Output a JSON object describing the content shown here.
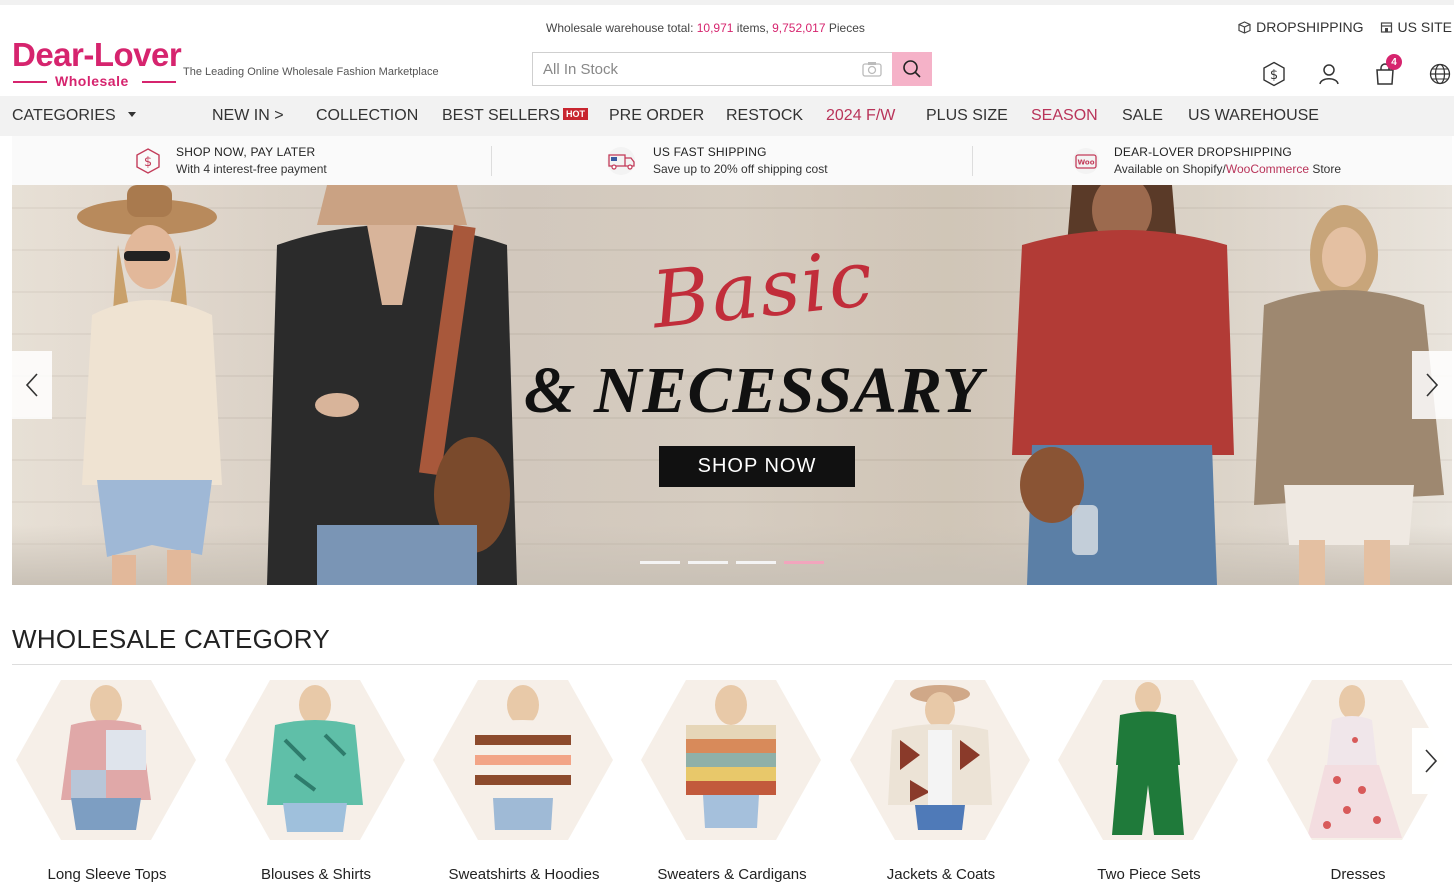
{
  "header": {
    "logo_main": "Dear-Lover",
    "logo_sub": "Wholesale",
    "tagline": "The Leading Online Wholesale Fashion Marketplace",
    "warehouse_prefix": "Wholesale warehouse total: ",
    "warehouse_items": "10,971",
    "warehouse_items_suffix": " items, ",
    "warehouse_pieces": "9,752,017",
    "warehouse_pieces_suffix": " Pieces",
    "search_placeholder": "All In Stock",
    "dropshipping_label": "DROPSHIPPING",
    "us_site_label": "US SITE",
    "cart_count": "4",
    "icons": [
      "currency-icon",
      "user-icon",
      "cart-icon",
      "globe-icon"
    ]
  },
  "nav": {
    "categories_label": "CATEGORIES",
    "items": [
      "NEW IN >",
      "COLLECTION",
      "BEST SELLERS",
      "PRE ORDER",
      "RESTOCK",
      "2024 F/W",
      "PLUS SIZE",
      "SEASON",
      "SALE",
      "US WAREHOUSE"
    ],
    "hot_badge": "HOT",
    "highlight_color": "#b9345a"
  },
  "perks": [
    {
      "title": "SHOP NOW, PAY LATER",
      "subtitle": "With 4 interest-free payment",
      "icon": "dollar-badge-icon"
    },
    {
      "title": "US FAST  SHIPPING",
      "subtitle": "Save up to 20% off shipping cost",
      "icon": "truck-icon"
    },
    {
      "title": "DEAR-LOVER DROPSHIPPING",
      "subtitle_prefix": "Available on Shopify/",
      "subtitle_highlight": "WooCommerce",
      "subtitle_suffix": " Store",
      "icon": "woo-icon"
    }
  ],
  "banner": {
    "script_text": "Basic",
    "headline": "& NECESSARY",
    "cta": "SHOP NOW",
    "slide_count": 4,
    "active_slide": 4
  },
  "category_section": {
    "title": "WHOLESALE CATEGORY",
    "items": [
      {
        "label": "Long Sleeve Tops"
      },
      {
        "label": "Blouses & Shirts"
      },
      {
        "label": "Sweatshirts & Hoodies"
      },
      {
        "label": "Sweaters & Cardigans"
      },
      {
        "label": "Jackets & Coats"
      },
      {
        "label": "Two Piece Sets"
      },
      {
        "label": "Dresses"
      }
    ]
  },
  "colors": {
    "brand": "#d6246e",
    "search_button": "#f5b2c8",
    "accent_red": "#c12d3a"
  }
}
